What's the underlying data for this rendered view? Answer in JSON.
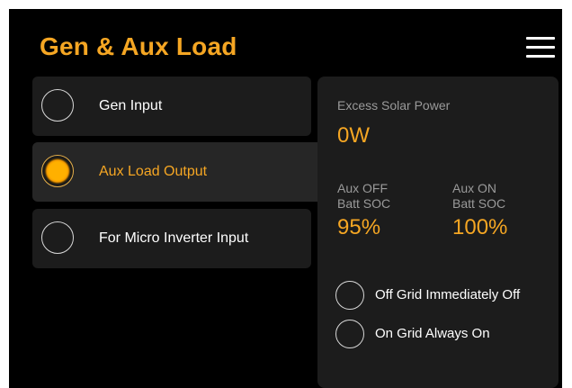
{
  "header": {
    "title": "Gen & Aux Load",
    "menu_icon": "hamburger-menu-icon"
  },
  "options": [
    {
      "label": "Gen Input",
      "selected": false
    },
    {
      "label": "Aux Load Output",
      "selected": true
    },
    {
      "label": "For Micro Inverter Input",
      "selected": false
    }
  ],
  "panel": {
    "excess_label": "Excess Solar Power",
    "excess_value": "0W",
    "aux_off_label_1": "Aux OFF",
    "aux_off_label_2": "Batt SOC",
    "aux_off_value": "95%",
    "aux_on_label_1": "Aux ON",
    "aux_on_label_2": "Batt SOC",
    "aux_on_value": "100%",
    "grid_options": [
      {
        "label": "Off Grid Immediately Off",
        "selected": false
      },
      {
        "label": "On Grid Always On",
        "selected": false
      }
    ]
  },
  "colors": {
    "accent": "#f5a623",
    "background": "#000000",
    "card": "#1c1c1c",
    "muted_text": "#9a9a9a"
  }
}
